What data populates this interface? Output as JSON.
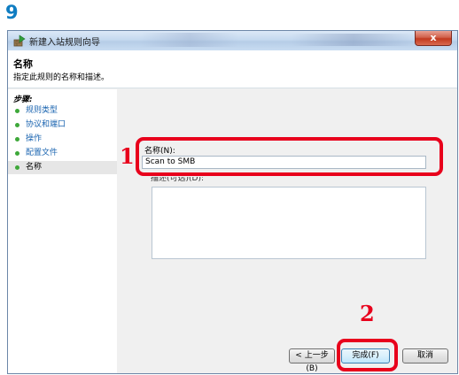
{
  "step_number": "9",
  "window": {
    "title": "新建入站规则向导",
    "close_label": "x"
  },
  "header": {
    "title": "名称",
    "description": "指定此规则的名称和描述。"
  },
  "sidebar": {
    "steps_label": "步骤:",
    "items": [
      {
        "label": "规则类型",
        "active": false
      },
      {
        "label": "协议和端口",
        "active": false
      },
      {
        "label": "操作",
        "active": false
      },
      {
        "label": "配置文件",
        "active": false
      },
      {
        "label": "名称",
        "active": true
      }
    ]
  },
  "form": {
    "name_label": "名称(N):",
    "name_value": "Scan to SMB",
    "description_label": "描述(可选)(D):",
    "description_value": ""
  },
  "buttons": {
    "back": "< 上一步(B)",
    "finish": "完成(F)",
    "cancel": "取消"
  },
  "callouts": {
    "marker_1": "1",
    "marker_2": "2"
  },
  "colors": {
    "step_number": "#0f7dc2",
    "callout": "#e8001c",
    "link": "#1a64b0",
    "step_dot": "#3ea83a"
  }
}
